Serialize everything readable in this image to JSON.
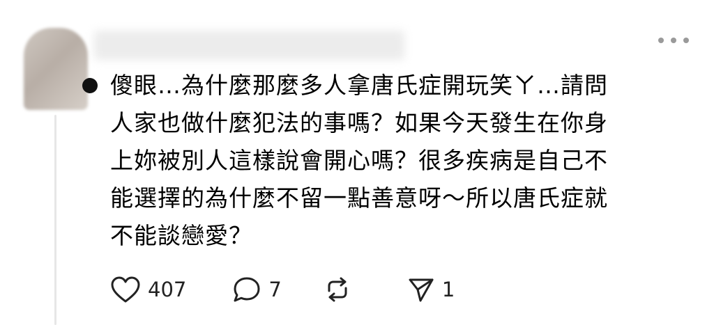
{
  "post": {
    "lines": [
      "傻眼…為什麼那麼多人拿唐氏症開玩笑ㄚ…請問",
      "人家也做什麼犯法的事嗎？如果今天發生在你身",
      "上妳被別人這樣說會開心嗎？很多疾病是自己不",
      "能選擇的為什麼不留一點善意呀～所以唐氏症就",
      "不能談戀愛？"
    ]
  },
  "actions": {
    "like_count": "407",
    "reply_count": "7",
    "repost_count": "",
    "share_count": "1"
  },
  "icons": {
    "like": "heart-icon",
    "reply": "comment-bubble-icon",
    "repost": "repost-icon",
    "share": "send-icon",
    "more": "more-horizontal-icon"
  },
  "colors": {
    "text": "#000000",
    "icon": "#222222",
    "muted": "#9a9a9a",
    "thread_line": "#e6e6e6"
  }
}
